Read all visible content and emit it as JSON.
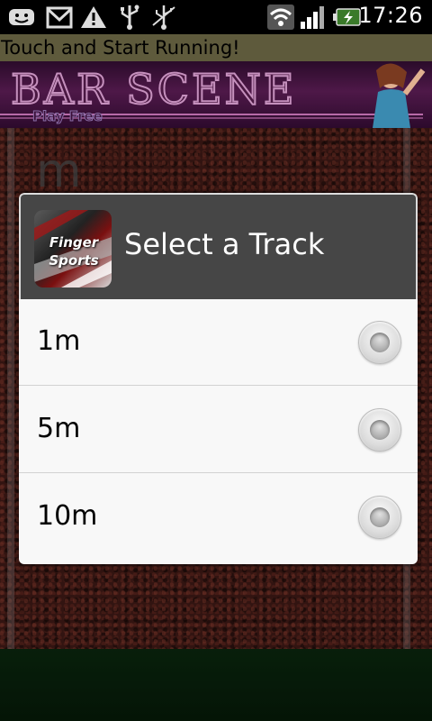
{
  "status_bar": {
    "icons": [
      "chat-icon",
      "gmail-icon",
      "warning-icon",
      "usb-icon",
      "usb-debug-icon",
      "wifi-icon",
      "signal-icon",
      "battery-icon"
    ],
    "time": "17:26"
  },
  "app": {
    "title": "Touch and Start Running!"
  },
  "ad_banner": {
    "title": "BAR SCENE",
    "subtitle": "Play Free"
  },
  "background": {
    "letter": "m"
  },
  "dialog": {
    "title": "Select a Track",
    "icon_text": [
      "Finger",
      "Sports"
    ],
    "options": [
      {
        "label": "1m",
        "selected": false
      },
      {
        "label": "5m",
        "selected": false
      },
      {
        "label": "10m",
        "selected": false
      }
    ]
  },
  "colors": {
    "title_bar": "#5e5a3c",
    "dialog_header": "#464646",
    "dialog_body": "#f8f8f8",
    "track": "#4b1f1a",
    "grass": "#0b2a0f"
  }
}
